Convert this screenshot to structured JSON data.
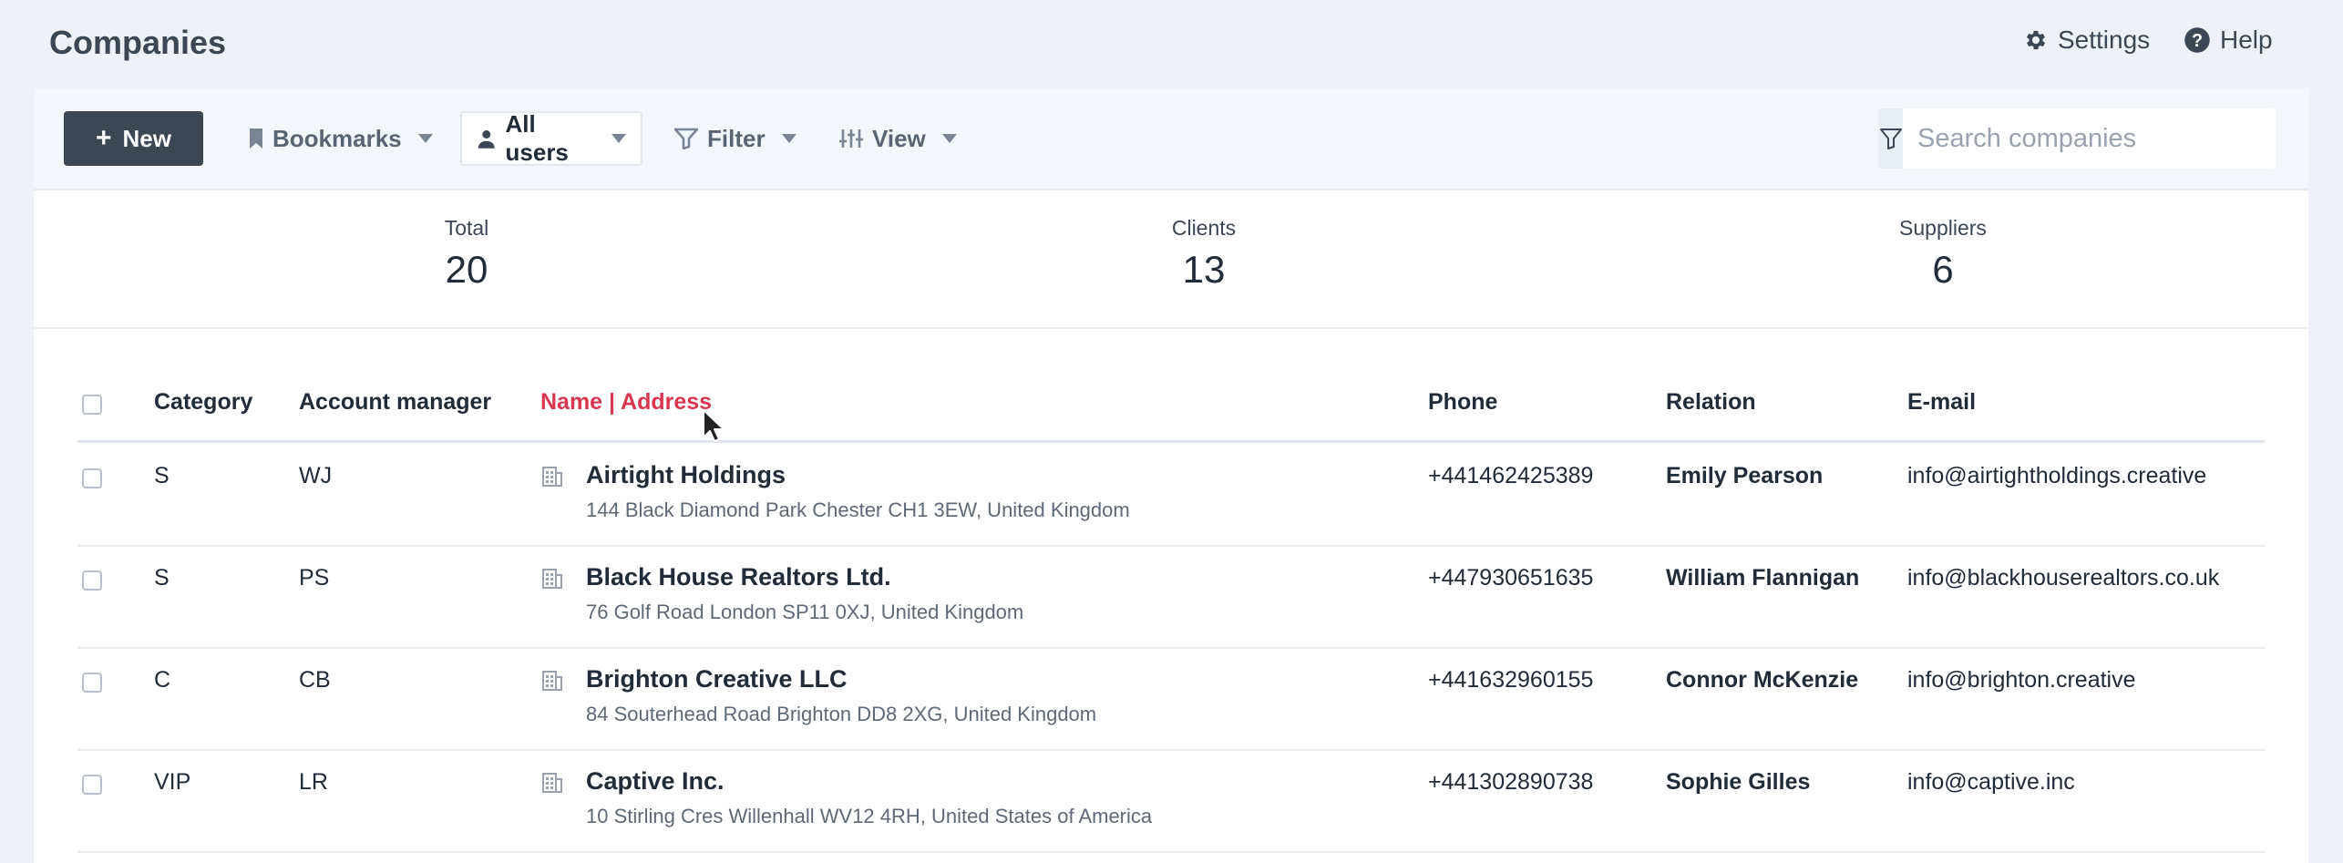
{
  "header": {
    "title": "Companies",
    "settings_label": "Settings",
    "help_label": "Help"
  },
  "toolbar": {
    "new_label": "New",
    "bookmarks_label": "Bookmarks",
    "all_users_label": "All users",
    "filter_label": "Filter",
    "view_label": "View",
    "search_placeholder": "Search companies",
    "search_value": ""
  },
  "stats": [
    {
      "label": "Total",
      "value": "20"
    },
    {
      "label": "Clients",
      "value": "13"
    },
    {
      "label": "Suppliers",
      "value": "6"
    }
  ],
  "table": {
    "columns": {
      "category": "Category",
      "account_manager": "Account manager",
      "name_address": "Name | Address",
      "phone": "Phone",
      "relation": "Relation",
      "email": "E-mail"
    },
    "rows": [
      {
        "category": "S",
        "manager": "WJ",
        "name": "Airtight Holdings",
        "address": "144 Black Diamond Park Chester CH1 3EW, United Kingdom",
        "phone": "+441462425389",
        "relation": "Emily Pearson",
        "email": "info@airtightholdings.creative"
      },
      {
        "category": "S",
        "manager": "PS",
        "name": "Black House Realtors Ltd.",
        "address": "76 Golf Road London SP11 0XJ, United Kingdom",
        "phone": "+447930651635",
        "relation": "William Flannigan",
        "email": "info@blackhouserealtors.co.uk"
      },
      {
        "category": "C",
        "manager": "CB",
        "name": "Brighton Creative LLC",
        "address": "84 Souterhead Road Brighton DD8 2XG, United Kingdom",
        "phone": "+441632960155",
        "relation": "Connor McKenzie",
        "email": "info@brighton.creative"
      },
      {
        "category": "VIP",
        "manager": "LR",
        "name": "Captive Inc.",
        "address": "10 Stirling Cres Willenhall WV12 4RH, United States of America",
        "phone": "+441302890738",
        "relation": "Sophie Gilles",
        "email": "info@captive.inc"
      }
    ]
  },
  "colors": {
    "accent": "#d9364f",
    "primary_button": "#3d4654",
    "background": "#eef1f7"
  }
}
